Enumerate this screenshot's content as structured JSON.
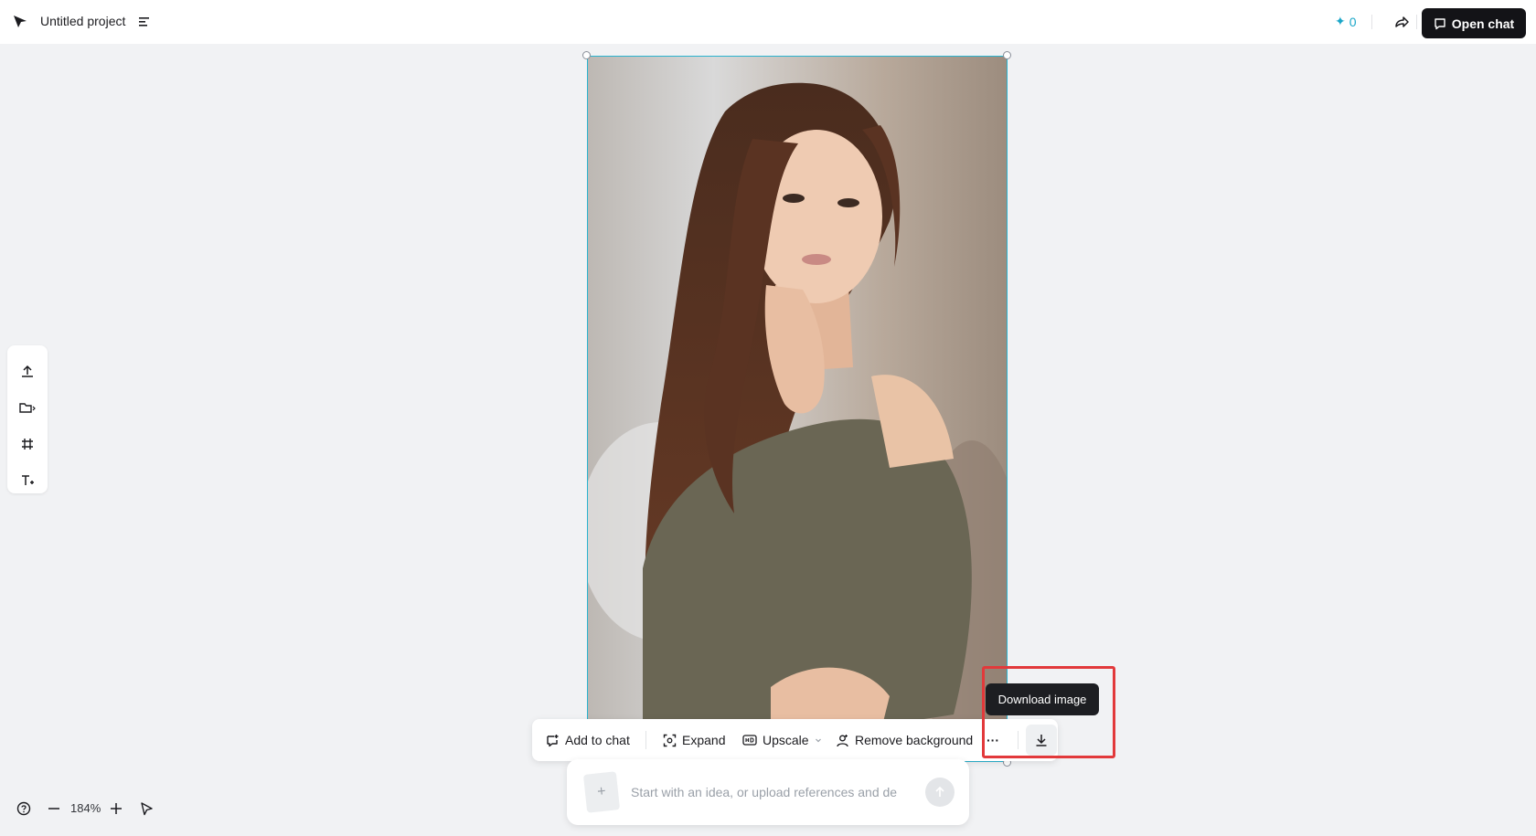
{
  "header": {
    "project_title": "Untitled project",
    "credits": "0",
    "open_chat_label": "Open chat"
  },
  "left_tools": {
    "items": [
      "upload-icon",
      "folder-icon",
      "frame-icon",
      "text-icon"
    ]
  },
  "zoom": {
    "level": "184%"
  },
  "image_actions": {
    "add_to_chat": "Add to chat",
    "expand": "Expand",
    "upscale": "Upscale",
    "remove_background": "Remove background",
    "more": "···"
  },
  "tooltip": {
    "label": "Download image"
  },
  "prompt": {
    "placeholder": "Start with an idea, or upload references and de",
    "add_symbol": "+"
  },
  "colors": {
    "accent": "#2ab3cf",
    "primary_button": "#131317",
    "highlight": "#e2393b",
    "background": "#f1f2f4"
  }
}
